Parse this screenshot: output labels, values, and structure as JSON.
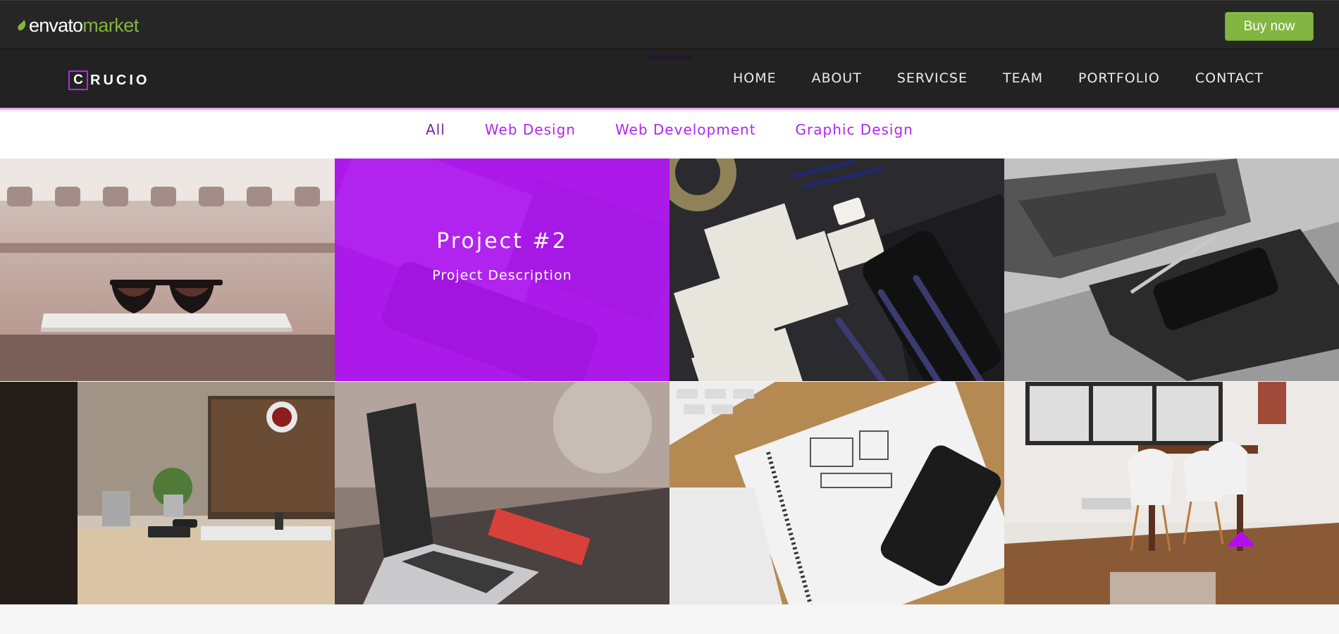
{
  "envato": {
    "logo_word": "envato",
    "logo_suffix": "market",
    "buy_label": "Buy now"
  },
  "brand": {
    "initial": "C",
    "rest": "RUCIO"
  },
  "nav": {
    "items": [
      {
        "label": "HOME"
      },
      {
        "label": "ABOUT"
      },
      {
        "label": "SERVICSE"
      },
      {
        "label": "TEAM"
      },
      {
        "label": "PORTFOLIO"
      },
      {
        "label": "CONTACT"
      }
    ]
  },
  "filters": [
    {
      "label": "All",
      "active": true
    },
    {
      "label": "Web Design",
      "active": false
    },
    {
      "label": "Web Development",
      "active": false
    },
    {
      "label": "Graphic Design",
      "active": false
    }
  ],
  "portfolio": {
    "hover_item": {
      "title": "Project #2",
      "description": "Project Description"
    },
    "images": [
      {
        "icon": "sunglasses-on-laptop-photo"
      },
      {
        "icon": "phone-keyboard-photo"
      },
      {
        "icon": "wireframe-sketches-photo"
      },
      {
        "icon": "laptop-phone-notebook-photo"
      },
      {
        "icon": "desk-monitor-photo"
      },
      {
        "icon": "macbook-red-notebook-photo"
      },
      {
        "icon": "notebook-wireframe-photo"
      },
      {
        "icon": "dining-chairs-room-photo"
      }
    ]
  },
  "colors": {
    "accent": "#b026f2",
    "envato_green": "#82b541",
    "header_bg": "#222222"
  }
}
